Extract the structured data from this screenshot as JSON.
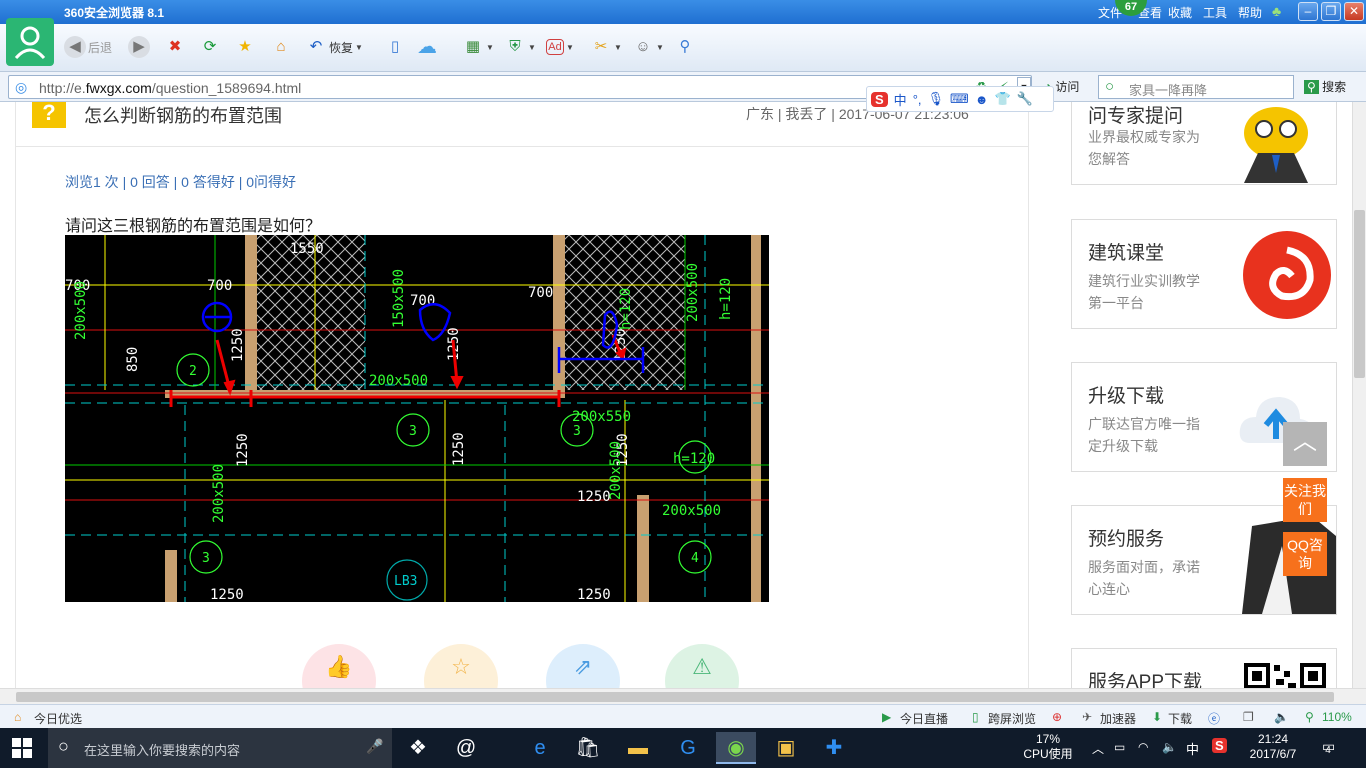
{
  "titlebar": {
    "title": "360安全浏览器 8.1",
    "menu": [
      "文件",
      "查看",
      "收藏",
      "工具",
      "帮助"
    ],
    "badge": "67"
  },
  "toolbar": {
    "back_label": "后退",
    "restore_label": "恢复"
  },
  "address": {
    "url_prefix": "http://e.",
    "url_domain": "fwxgx.com",
    "url_path": "/question_1589694.html",
    "visit_label": "访问",
    "search_placeholder": "家具一降再降",
    "search_label": "搜索"
  },
  "ime": {
    "logo": "S",
    "mode": "中"
  },
  "question": {
    "icon": "?",
    "title": "怎么判断钢筋的布置范围",
    "meta": "广东 | 我丢了 | 2017-06-07 21:23:06",
    "stats": "浏览1 次 | 0 回答 | 0 答得好 | 0问得好",
    "body": "请问这三根钢筋的布置范围是如何？"
  },
  "cad_labels": {
    "dims": [
      "700",
      "700",
      "700",
      "1550",
      "850",
      "1250",
      "1250",
      "1250",
      "1250",
      "1250",
      "1250",
      "1250",
      "1250",
      "1250",
      "h=120",
      "h=120",
      "h=120"
    ],
    "beams": [
      "200x500",
      "200x500",
      "200x500",
      "150x500",
      "200x500",
      "200x550",
      "200x500",
      "200x500"
    ],
    "circles": [
      "2",
      "3",
      "3",
      "3",
      "3",
      "4"
    ],
    "slab": "LB3"
  },
  "actions": [
    "like",
    "favorite",
    "share",
    "report"
  ],
  "sidebar": {
    "cards": [
      {
        "title": "问专家提问",
        "desc": "业界最权威专家为您解答"
      },
      {
        "title": "建筑课堂",
        "desc": "建筑行业实训教学第一平台"
      },
      {
        "title": "升级下载",
        "desc": "广联达官方唯一指定升级下载"
      },
      {
        "title": "预约服务",
        "desc": "服务面对面，承诺心连心"
      },
      {
        "title": "服务APP下载",
        "desc": ""
      }
    ],
    "follow": "关注我们",
    "qq": "QQ咨询"
  },
  "statusbar": {
    "left": "今日优选",
    "live": "今日直播",
    "cross": "跨屏浏览",
    "speed": "加速器",
    "download": "下载",
    "zoom": "110%"
  },
  "taskbar": {
    "search_placeholder": "在这里输入你要搜索的内容",
    "cpu_pct": "17%",
    "cpu_label": "CPU使用",
    "ime": "中",
    "time": "21:24",
    "date": "2017/6/7",
    "notifications": "4"
  },
  "colors": {
    "title_blue": "#1f6fd1",
    "link_blue": "#3a6fb5",
    "accent_orange": "#f7711c",
    "question_yellow": "#f5c400"
  }
}
